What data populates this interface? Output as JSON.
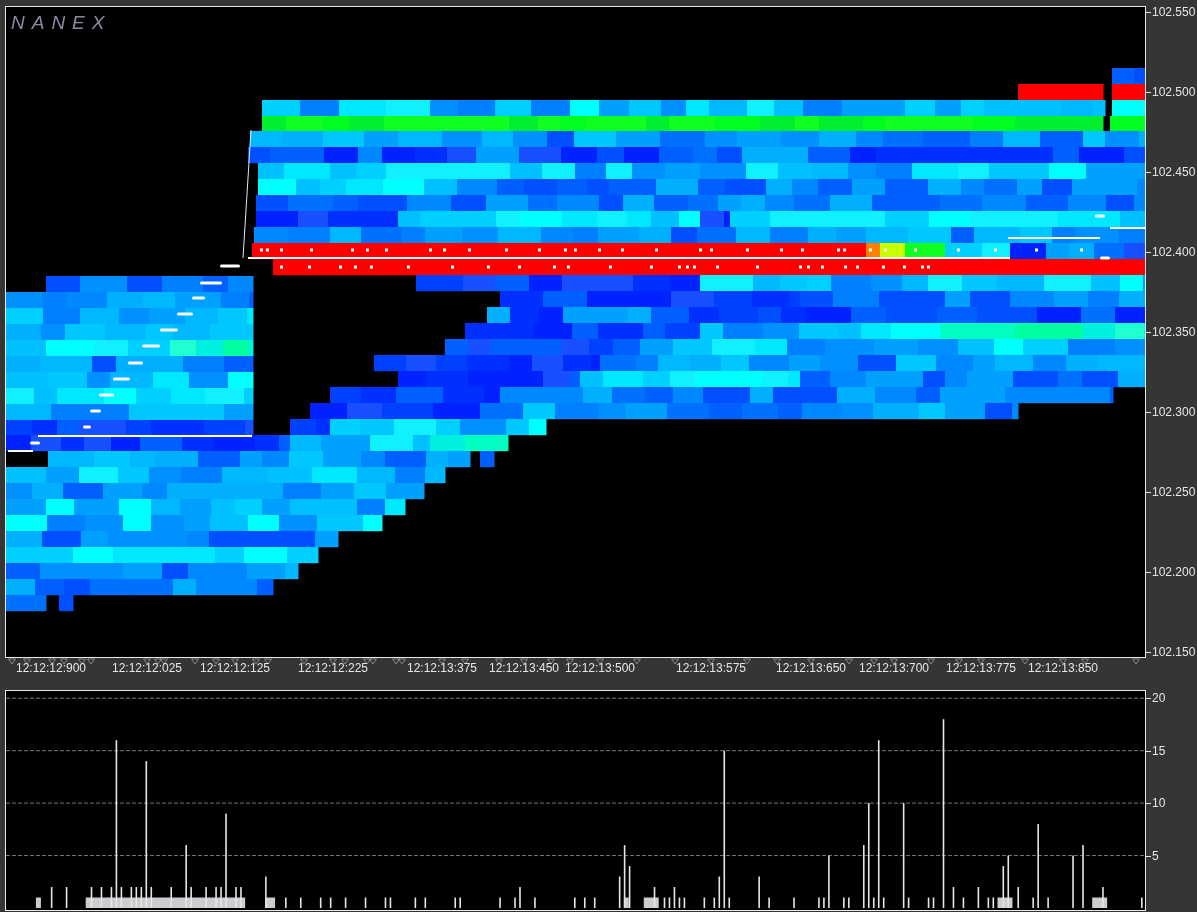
{
  "logo": {
    "text": "NANEX"
  },
  "price_chart": {
    "y_axis_labels": [
      "102.550",
      "102.500",
      "102.450",
      "102.400",
      "102.350",
      "102.300",
      "102.250",
      "102.200",
      "102.150"
    ],
    "time_labels": [
      "12:12:12:900",
      "12:12:12:025",
      "12:12:12:125",
      "12:12:12:225",
      "12:12:13:375",
      "12:12:13:450",
      "12:12:13:500",
      "12:12:13:575",
      "12:12:13:650",
      "12:12:13:700",
      "12:12:13:775",
      "12:12:13:850"
    ]
  },
  "volume_chart": {
    "y_axis_labels": [
      "20",
      "15",
      "10",
      "5"
    ]
  }
}
